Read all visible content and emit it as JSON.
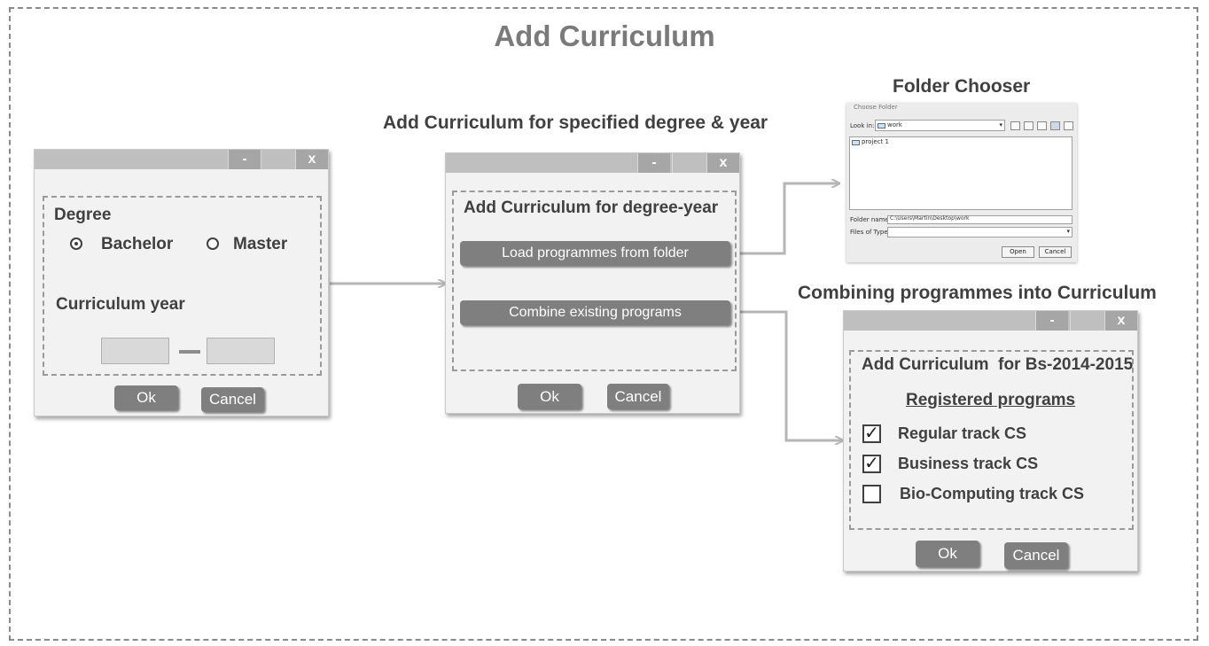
{
  "title": "Add Curriculum",
  "sections": {
    "specified": "Add Curriculum for specified degree & year",
    "folder_chooser": "Folder Chooser",
    "combining": "Combining programmes into Curriculum"
  },
  "window_controls": {
    "minimize": "-",
    "close": "x"
  },
  "dialog1": {
    "degree_label": "Degree",
    "options": [
      "Bachelor",
      "Master"
    ],
    "selected": "Bachelor",
    "year_label": "Curriculum year",
    "ok": "Ok",
    "cancel": "Cancel"
  },
  "dialog2": {
    "heading": "Add Curriculum for degree-year",
    "load_button": "Load programmes from folder",
    "combine_button": "Combine existing programs",
    "ok": "Ok",
    "cancel": "Cancel"
  },
  "chooser": {
    "window_title": "Choose Folder",
    "look_in_label": "Look in:",
    "look_in_value": "work",
    "items": [
      "project 1"
    ],
    "folder_name_label": "Folder name:",
    "folder_name_value": "C:\\Users\\Martin\\Desktop\\work",
    "files_of_type_label": "Files of Type:",
    "open": "Open",
    "cancel": "Cancel"
  },
  "dialog3": {
    "heading": "Add Curriculum  for Bs-2014-2015",
    "subheading": "Registered programs",
    "programs": [
      {
        "label": "Regular track CS",
        "checked": true
      },
      {
        "label": "Business track CS",
        "checked": true
      },
      {
        "label": "Bio-Computing track CS",
        "checked": false
      }
    ],
    "check_mark": "✓",
    "ok": "Ok",
    "cancel": "Cancel"
  }
}
